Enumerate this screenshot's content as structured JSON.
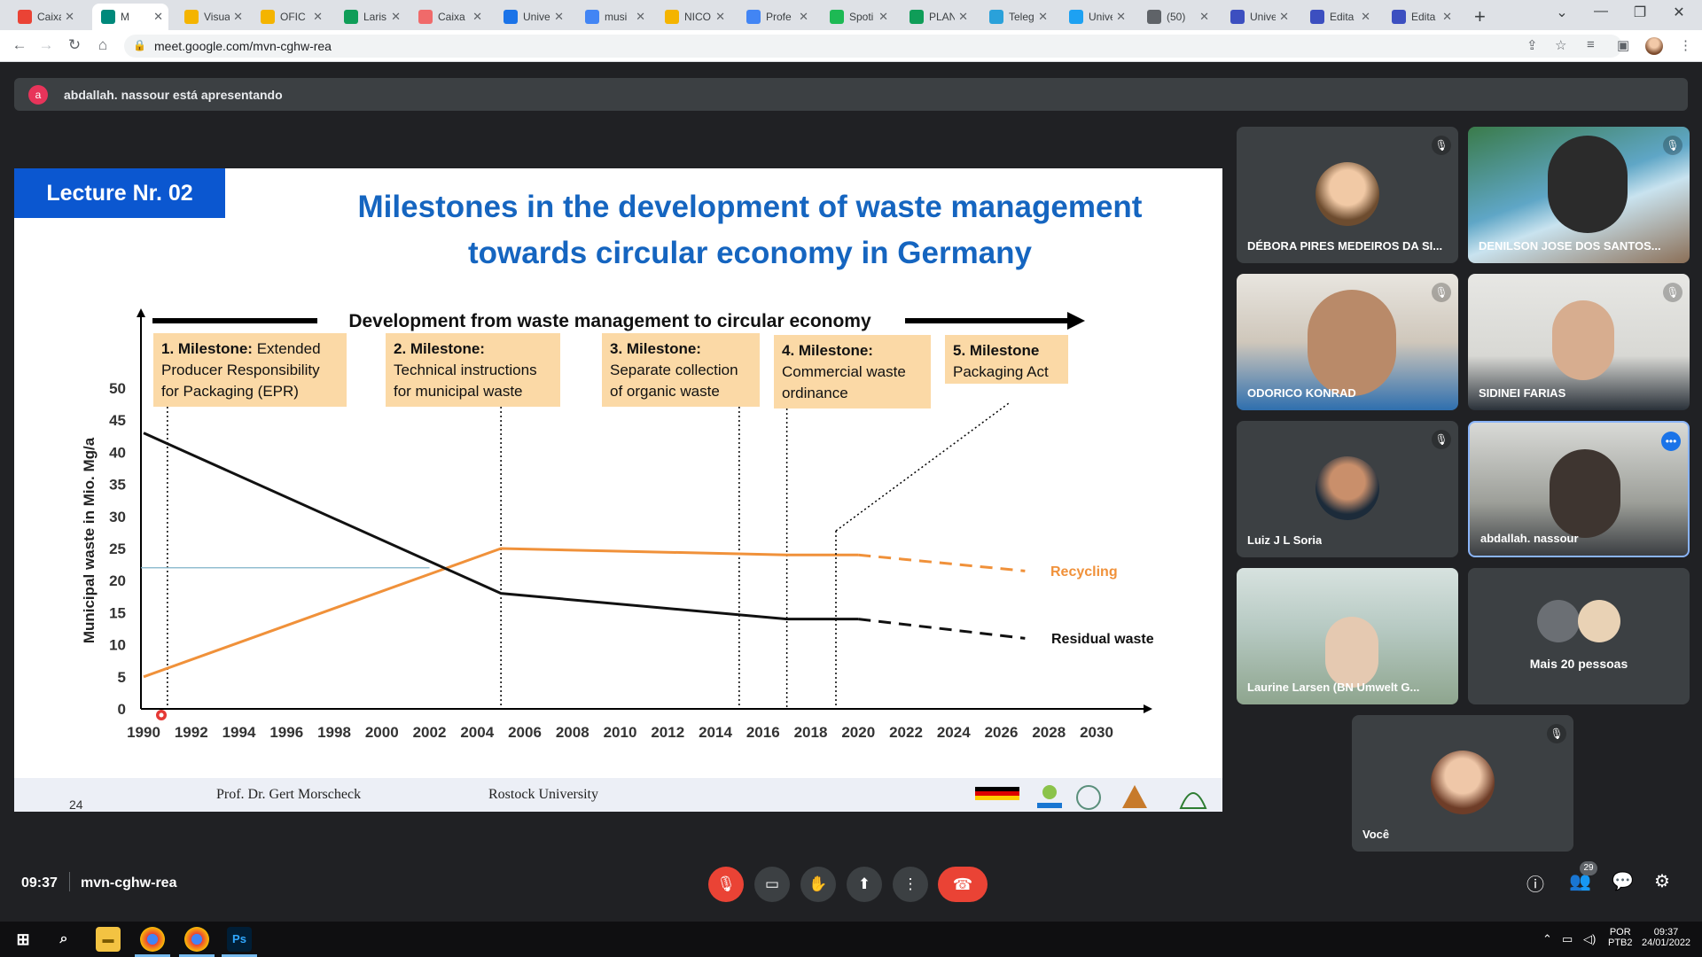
{
  "browser": {
    "tabs": [
      {
        "label": "Caixa",
        "icon": "gmail-icon",
        "color": "#ea4335"
      },
      {
        "label": "M",
        "icon": "meet-icon",
        "color": "#00897b",
        "active": true
      },
      {
        "label": "Visua",
        "icon": "drive-icon",
        "color": "#f4b400"
      },
      {
        "label": "OFIC",
        "icon": "drive-icon",
        "color": "#f4b400"
      },
      {
        "label": "Laris",
        "icon": "chat-icon",
        "color": "#0f9d58"
      },
      {
        "label": "Caixa",
        "icon": "asana-icon",
        "color": "#f06a6a"
      },
      {
        "label": "Unive",
        "icon": "calendar-icon",
        "color": "#1a73e8"
      },
      {
        "label": "musi",
        "icon": "docs-icon",
        "color": "#4285f4"
      },
      {
        "label": "NICO",
        "icon": "drive-icon",
        "color": "#f4b400"
      },
      {
        "label": "Profe",
        "icon": "docs-icon",
        "color": "#4285f4"
      },
      {
        "label": "Spoti",
        "icon": "spotify-icon",
        "color": "#1db954"
      },
      {
        "label": "PLAN",
        "icon": "sheets-icon",
        "color": "#0f9d58"
      },
      {
        "label": "Teleg",
        "icon": "telegram-icon",
        "color": "#2aa1da"
      },
      {
        "label": "Unive",
        "icon": "twitter-icon",
        "color": "#1da1f2"
      },
      {
        "label": "(50)",
        "icon": "generic-icon",
        "color": "#5f6368"
      },
      {
        "label": "Unive",
        "icon": "globe-icon",
        "color": "#3c4fc0"
      },
      {
        "label": "Edita",
        "icon": "globe-icon",
        "color": "#3c4fc0"
      },
      {
        "label": "Edita",
        "icon": "globe-icon",
        "color": "#3c4fc0"
      }
    ],
    "url": "meet.google.com/mvn-cghw-rea"
  },
  "meet": {
    "presenter_initial": "a",
    "presenting_text": "abdallah. nassour está apresentando",
    "time": "09:37",
    "meeting_code": "mvn-cghw-rea",
    "people_count": "29",
    "participants": [
      {
        "name": "DÉBORA PIRES MEDEIROS DA SI...",
        "muted": true
      },
      {
        "name": "DENILSON JOSE DOS SANTOS...",
        "muted": true
      },
      {
        "name": "ODORICO KONRAD",
        "muted": true
      },
      {
        "name": "SIDINEI FARIAS",
        "muted": true
      },
      {
        "name": "Luiz J L Soria",
        "muted": true
      },
      {
        "name": "abdallah. nassour",
        "muted": false
      },
      {
        "name": "Laurine Larsen (BN Umwelt G...",
        "muted": false
      },
      {
        "name": "Mais 20 pessoas",
        "muted": false
      },
      {
        "name": "Você",
        "muted": true
      }
    ]
  },
  "slide": {
    "lecture": "Lecture Nr. 02",
    "title_line1": "Milestones in the development of waste management",
    "title_line2": "towards circular economy in Germany",
    "arrow_label": "Development from waste management to circular economy",
    "ylabel": "Municipal waste in Mio. Mg/a",
    "milestones": [
      {
        "bold": "1. Milestone:",
        "rest": " Extended",
        "line2": "Producer Responsibility",
        "line3": "for Packaging (EPR)"
      },
      {
        "bold": "2. Milestone:",
        "rest": "",
        "line2": "Technical instructions",
        "line3": "for municipal waste"
      },
      {
        "bold": "3. Milestone:",
        "rest": "",
        "line2": "Separate collection",
        "line3": "of organic waste"
      },
      {
        "bold": "4. Milestone:",
        "rest": "",
        "line2": "Commercial waste",
        "line3": "ordinance"
      },
      {
        "bold": "5. Milestone",
        "rest": "",
        "line2": "Packaging Act",
        "line3": ""
      }
    ],
    "page_number": "24",
    "footer_prof": "Prof. Dr. Gert Morscheck",
    "footer_uni": "Rostock University",
    "logos": [
      "german cooperation",
      "PREVENT",
      "seal",
      "PHARAOH",
      "crest"
    ]
  },
  "chart_data": {
    "type": "line",
    "x_ticks": [
      1990,
      1992,
      1994,
      1996,
      1998,
      2000,
      2002,
      2004,
      2006,
      2008,
      2010,
      2012,
      2014,
      2016,
      2018,
      2020,
      2022,
      2024,
      2026,
      2028,
      2030
    ],
    "y_ticks": [
      0,
      5,
      10,
      15,
      20,
      25,
      30,
      35,
      40,
      45,
      50
    ],
    "xlim": [
      1990,
      2030
    ],
    "ylim": [
      0,
      50
    ],
    "ylabel": "Municipal waste in Mio. Mg/a",
    "series": [
      {
        "name": "Recycling",
        "color": "#f0913a",
        "x": [
          1990,
          2005,
          2017,
          2020
        ],
        "y": [
          5,
          25,
          24,
          24
        ],
        "projection_x": [
          2020,
          2027
        ],
        "projection_y": [
          24,
          21.5
        ]
      },
      {
        "name": "Residual waste",
        "color": "#111111",
        "x": [
          1990,
          2005,
          2017,
          2020
        ],
        "y": [
          43,
          18,
          14,
          14
        ],
        "projection_x": [
          2020,
          2027
        ],
        "projection_y": [
          14,
          11
        ]
      }
    ],
    "milestone_years": [
      1991,
      2005,
      2015,
      2017,
      2019
    ]
  }
}
